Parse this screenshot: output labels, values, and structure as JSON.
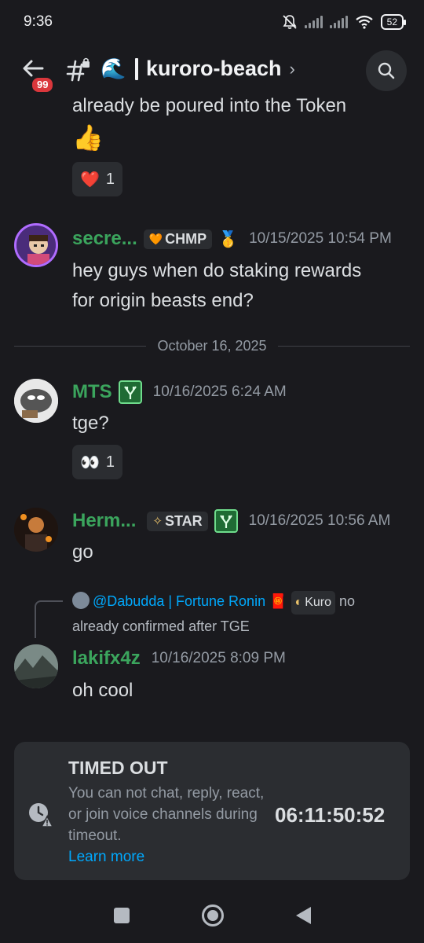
{
  "status_bar": {
    "time": "9:36",
    "battery": "52"
  },
  "header": {
    "badge_count": "99",
    "channel_emoji": "🌊",
    "channel_name": "kuroro-beach",
    "chevron": "›"
  },
  "messages": {
    "cont": {
      "text_line1": "already be poured into the Token",
      "emoji": "👍",
      "reaction": {
        "emoji": "❤️",
        "count": "1"
      }
    },
    "m1": {
      "username": "secre...",
      "tag_icon": "🧡",
      "tag": "CHMP",
      "medal": "🥇",
      "timestamp": "10/15/2025 10:54 PM",
      "text_line1": "hey guys when do staking rewards",
      "text_line2": "for origin beasts end?"
    },
    "date_divider": "October 16, 2025",
    "m2": {
      "username": "MTS",
      "timestamp": "10/16/2025 6:24 AM",
      "text": "tge?",
      "reaction": {
        "emoji": "👀",
        "count": "1"
      }
    },
    "m3": {
      "username": "Herm...",
      "tag_icon": "✧",
      "tag": "STAR",
      "timestamp": "10/16/2025 10:56 AM",
      "text": "go"
    },
    "m4": {
      "reply": {
        "mention": "@Dabudda | Fortune Ronin",
        "flag": "🧧",
        "tag_icon": "◐",
        "tag": "Kuro",
        "text_line1_end": "no",
        "text_line2": "already confirmed after TGE"
      },
      "username": "lakifx4z",
      "timestamp": "10/16/2025 8:09 PM",
      "text": "oh cool"
    }
  },
  "timeout": {
    "title": "TIMED OUT",
    "description": "You can not chat, reply, react, or join voice channels during timeout.",
    "link": "Learn more",
    "countdown": "06:11:50:52"
  },
  "colors": {
    "background": "#1a1a1e",
    "card": "#2b2d31",
    "username_green": "#3ba55d",
    "link_blue": "#00a8fc",
    "badge_red": "#da373c"
  },
  "icons": [
    "back-arrow-icon",
    "hashtag-lock-icon",
    "search-icon",
    "clock-lock-icon",
    "mute-icon",
    "wifi-icon"
  ]
}
